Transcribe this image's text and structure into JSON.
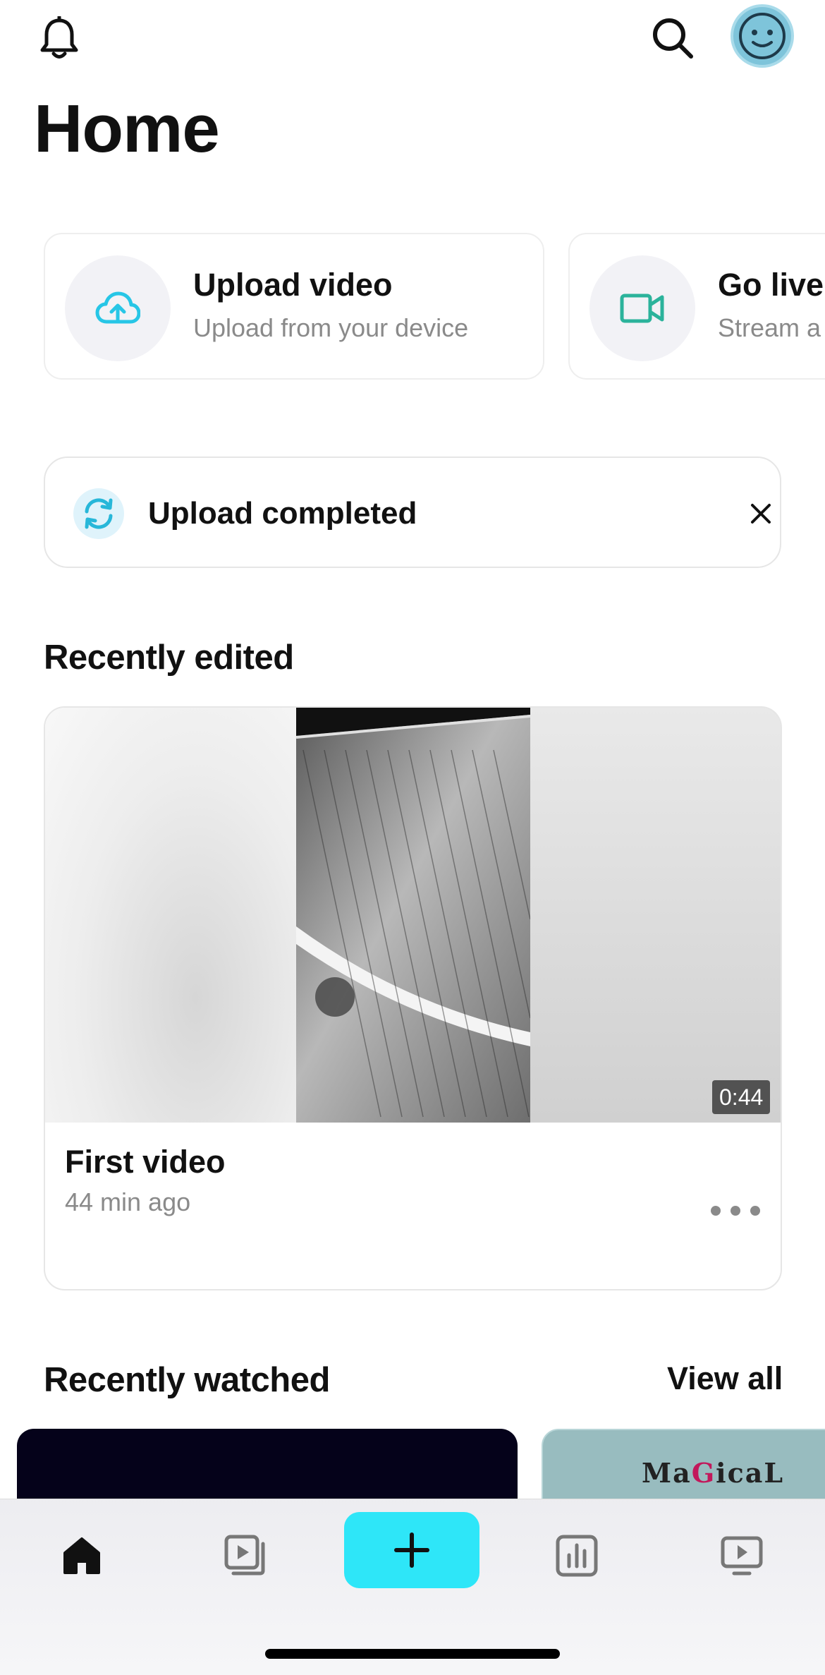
{
  "header": {
    "title": "Home",
    "icons": [
      "bell-icon",
      "search-icon",
      "avatar"
    ]
  },
  "quick_actions": [
    {
      "title": "Upload video",
      "subtitle": "Upload from your device",
      "icon": "cloud-upload-icon"
    },
    {
      "title": "Go live",
      "subtitle": "Stream a",
      "icon": "video-camera-icon"
    }
  ],
  "toast": {
    "message": "Upload completed",
    "icon": "sync-icon",
    "close_icon": "close-icon"
  },
  "recently_edited": {
    "title": "Recently edited",
    "video": {
      "title": "First video",
      "meta": "44 min ago",
      "duration": "0:44"
    }
  },
  "recently_watched": {
    "title": "Recently watched",
    "view_all": "View all",
    "cards": [
      {
        "label": ""
      },
      {
        "label": "MaGicaL"
      }
    ]
  },
  "tabbar": {
    "items": [
      "home-icon",
      "library-icon",
      "plus-icon",
      "analytics-icon",
      "watch-icon"
    ]
  },
  "colors": {
    "accent": "#2ee6f8",
    "upload_icon": "#27c6e6",
    "live_icon": "#2bb39b",
    "muted_text": "#8a8a8a"
  }
}
